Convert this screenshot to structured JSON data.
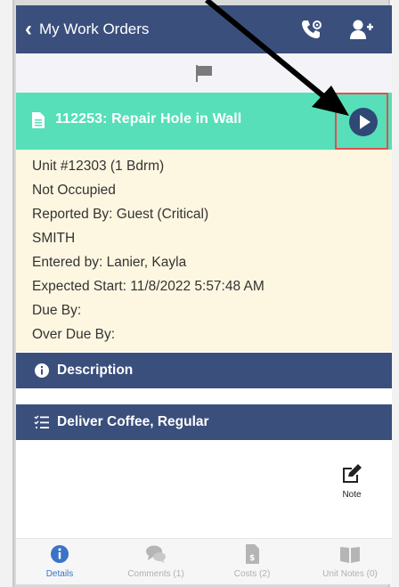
{
  "header": {
    "back_label": "My Work Orders",
    "back_icon": "chevron-left-icon",
    "phone_icon": "phone-settings-icon",
    "user_icon": "add-user-icon"
  },
  "flag_icon": "flag-icon",
  "work_order": {
    "title": "112253: Repair Hole in Wall",
    "doc_icon": "document-icon",
    "play_icon": "play-icon"
  },
  "details": {
    "unit": "Unit #12303 (1 Bdrm)",
    "occupancy": "Not Occupied",
    "reported_by": "Reported By: Guest  (Critical)",
    "name": "SMITH",
    "entered_by": "Entered by: Lanier, Kayla",
    "expected_start": "Expected Start: 11/8/2022 5:57:48 AM",
    "due_by": "Due By:",
    "over_due_by": "Over Due By:"
  },
  "sections": {
    "description": "Description",
    "task": "Deliver Coffee, Regular"
  },
  "note": {
    "label": "Note",
    "icon": "edit-icon"
  },
  "tabs": [
    {
      "label": "Details",
      "icon": "info-icon",
      "active": true
    },
    {
      "label": "Comments (1)",
      "icon": "comments-icon",
      "active": false
    },
    {
      "label": "Costs (2)",
      "icon": "invoice-icon",
      "active": false
    },
    {
      "label": "Unit Notes (0)",
      "icon": "book-icon",
      "active": false
    }
  ],
  "colors": {
    "header": "#3a4f7c",
    "banner": "#56dfb9",
    "details_bg": "#fdf7e1",
    "highlight_box": "#e05050",
    "active_tab": "#3a73c8"
  }
}
